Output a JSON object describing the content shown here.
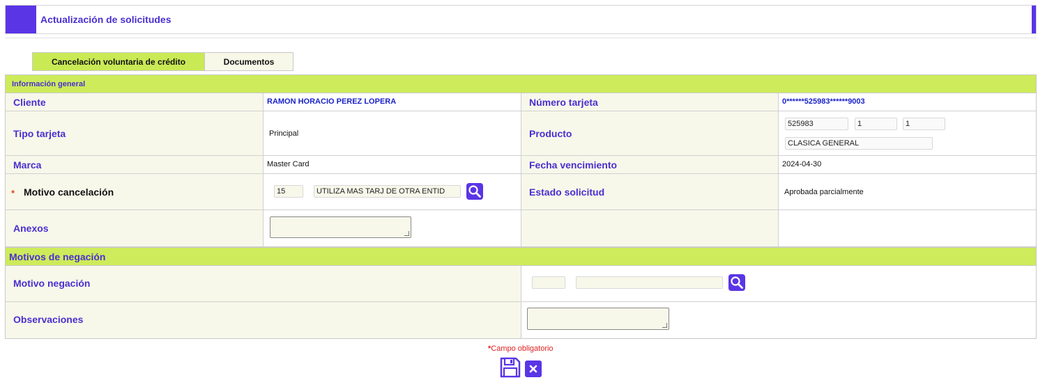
{
  "header": {
    "title": "Actualización de solicitudes"
  },
  "tabs": [
    {
      "label": "Cancelación voluntaria de crédito"
    },
    {
      "label": "Documentos"
    }
  ],
  "sections": {
    "general": "Información general",
    "negacion": "Motivos de negación"
  },
  "fields": {
    "cliente": {
      "label": "Cliente",
      "value": "RAMON HORACIO PEREZ LOPERA"
    },
    "numero_tarjeta": {
      "label": "Número tarjeta",
      "value": "0******525983******9003"
    },
    "tipo_tarjeta": {
      "label": "Tipo tarjeta",
      "value": "Principal"
    },
    "producto": {
      "label": "Producto",
      "code": "525983",
      "field2": "1",
      "field3": "1",
      "name": "CLASICA GENERAL"
    },
    "marca": {
      "label": "Marca",
      "value": "Master Card"
    },
    "fecha_vencimiento": {
      "label": "Fecha vencimiento",
      "value": "2024-04-30"
    },
    "motivo_cancelacion": {
      "label": "Motivo cancelación",
      "code": "15",
      "description": "UTILIZA MAS TARJ DE OTRA ENTID"
    },
    "estado_solicitud": {
      "label": "Estado solicitud",
      "value": "Aprobada parcialmente"
    },
    "anexos": {
      "label": "Anexos",
      "value": ""
    },
    "motivo_negacion": {
      "label": "Motivo negación",
      "code": "",
      "description": ""
    },
    "observaciones": {
      "label": "Observaciones",
      "value": ""
    }
  },
  "footer": {
    "required_star": "*",
    "required_note": "Campo obligatorio"
  },
  "icons": {
    "search": "search-icon",
    "save": "save-icon",
    "close": "close-icon"
  },
  "colors": {
    "accent": "#5a35e6",
    "section": "#cdeb5a",
    "label": "#4a2fd0",
    "required": "#e02020"
  }
}
